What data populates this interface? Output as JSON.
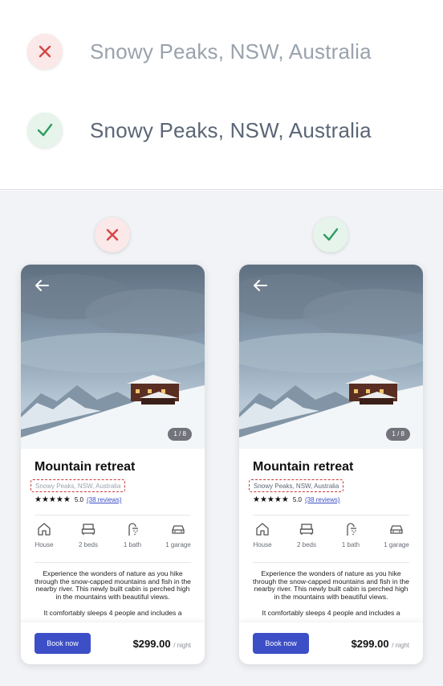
{
  "comparison": {
    "location_text": "Snowy Peaks, NSW, Australia",
    "bad_icon": "cross-icon",
    "good_icon": "check-icon",
    "bad_color": "#d64545",
    "good_color": "#2e9d5e"
  },
  "card": {
    "image_counter": "1 / 8",
    "title": "Mountain retreat",
    "address": "Snowy Peaks, NSW, Australia",
    "rating": {
      "stars": "★★★★★",
      "score": "5.0",
      "reviews": "(38 reviews)"
    },
    "amenities": [
      {
        "icon": "house-icon",
        "label": "House"
      },
      {
        "icon": "bed-icon",
        "label": "2 beds"
      },
      {
        "icon": "shower-icon",
        "label": "1 bath"
      },
      {
        "icon": "car-icon",
        "label": "1 garage"
      }
    ],
    "description_1": "Experience the wonders of nature as you hike through the snow-capped mountains and fish in the nearby river. This newly built cabin is perched high in the mountains with beautiful views.",
    "description_2": "It comfortably sleeps 4 people and includes a",
    "book_label": "Book now",
    "price": "$299.00",
    "price_unit": "/ night",
    "accent": "#3d4fc7"
  }
}
